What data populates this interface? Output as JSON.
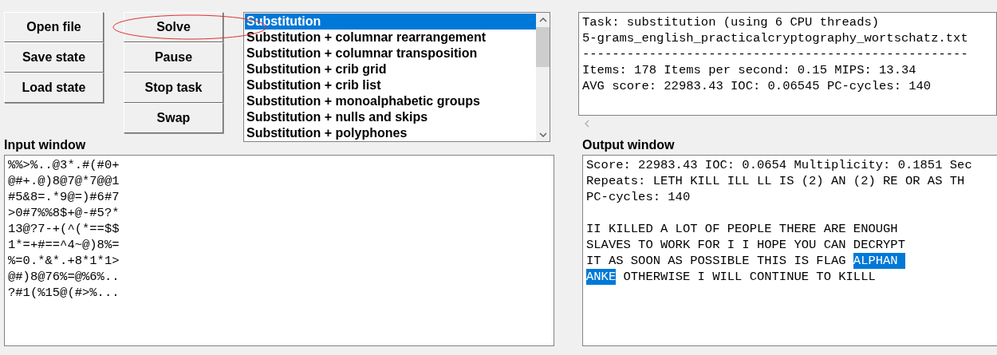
{
  "buttons_left": [
    "Open file",
    "Save state",
    "Load state"
  ],
  "buttons_right": [
    "Solve",
    "Pause",
    "Stop task",
    "Swap"
  ],
  "task_list": [
    {
      "label": "Substitution",
      "selected": true
    },
    {
      "label": "Substitution + columnar rearrangement",
      "selected": false
    },
    {
      "label": "Substitution + columnar transposition",
      "selected": false
    },
    {
      "label": "Substitution + crib grid",
      "selected": false
    },
    {
      "label": "Substitution + crib list",
      "selected": false
    },
    {
      "label": "Substitution + monoalphabetic groups",
      "selected": false
    },
    {
      "label": "Substitution + nulls and skips",
      "selected": false
    },
    {
      "label": "Substitution + polyphones",
      "selected": false
    }
  ],
  "status_lines": [
    "Task: substitution (using 6 CPU threads)",
    "5-grams_english_practicalcryptography_wortschatz.txt",
    "----------------------------------------------------",
    "Items: 178 Items per second: 0.15 MIPS: 13.34",
    "AVG score: 22983.43 IOC: 0.06545 PC-cycles: 140"
  ],
  "input_label": "Input window",
  "input_lines": [
    "%%>%..@3*.#(#0+",
    "@#+.@)8@7@*7@@1",
    "#5&8=.*9@=)#6#7",
    ">0#7%%8$+@-#5?*",
    "13@?7-+(^(*==$$",
    "1*=+#==^4~@)8%=",
    "%=0.*&*.+8*1*1>",
    "@#)8@76%=@%6%..",
    "?#1(%15@(#>%..."
  ],
  "output_label": "Output window",
  "output_header": [
    "Score: 22983.43 IOC: 0.0654 Multiplicity: 0.1851 Sec",
    "Repeats: LETH KILL ILL LL IS (2) AN (2) RE OR AS TH",
    "PC-cycles: 140"
  ],
  "output_lines": [
    [
      {
        "text": "II KILLED A LOT OF PEOPLE THERE ARE ENOUGH",
        "selected": false
      }
    ],
    [
      {
        "text": "SLAVES TO WORK FOR I I HOPE YOU CAN DECRYPT",
        "selected": false
      }
    ],
    [
      {
        "text": "IT AS SOON AS POSSIBLE THIS IS FLAG ",
        "selected": false
      },
      {
        "text": "ALPHAN ",
        "selected": true
      }
    ],
    [
      {
        "text": "ANKE",
        "selected": true
      },
      {
        "text": " OTHERWISE I WILL CONTINUE TO KILLL",
        "selected": false
      }
    ]
  ]
}
